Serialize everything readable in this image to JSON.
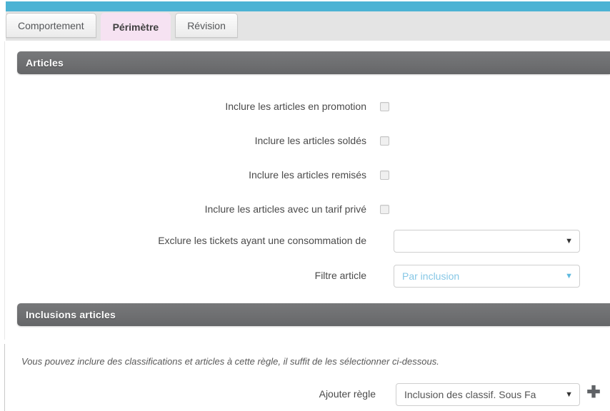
{
  "theme": {
    "accent_teal": "#4cb3d4",
    "tabstrip_bg": "#e4e4e4",
    "active_tab_bg": "#f6e2f2",
    "section_bar_gray": "#6e6f71",
    "placeholder_blue": "#86c7e6"
  },
  "tabs": [
    {
      "label": "Comportement",
      "active": false
    },
    {
      "label": "Périmètre",
      "active": true
    },
    {
      "label": "Révision",
      "active": false
    }
  ],
  "sections": {
    "articles": {
      "title": "Articles",
      "checkbox_rows": [
        {
          "label": "Inclure les articles en promotion",
          "checked": false
        },
        {
          "label": "Inclure les articles soldés",
          "checked": false
        },
        {
          "label": "Inclure les articles remisés",
          "checked": false
        },
        {
          "label": "Inclure les articles avec un tarif privé",
          "checked": false
        }
      ],
      "consommation": {
        "label": "Exclure les tickets ayant une consommation de",
        "value": "",
        "caret": "▼"
      },
      "filtre_article": {
        "label": "Filtre article",
        "value": "Par inclusion",
        "caret": "▼"
      }
    },
    "inclusions": {
      "title": "Inclusions articles",
      "note": "Vous pouvez inclure des classifications et articles à cette règle, il suffit de les sélectionner ci-dessous.",
      "ajouter_regle": {
        "label": "Ajouter règle",
        "value": "Inclusion des classif. Sous Fa",
        "caret": "▼"
      },
      "add_button": "✚"
    }
  }
}
